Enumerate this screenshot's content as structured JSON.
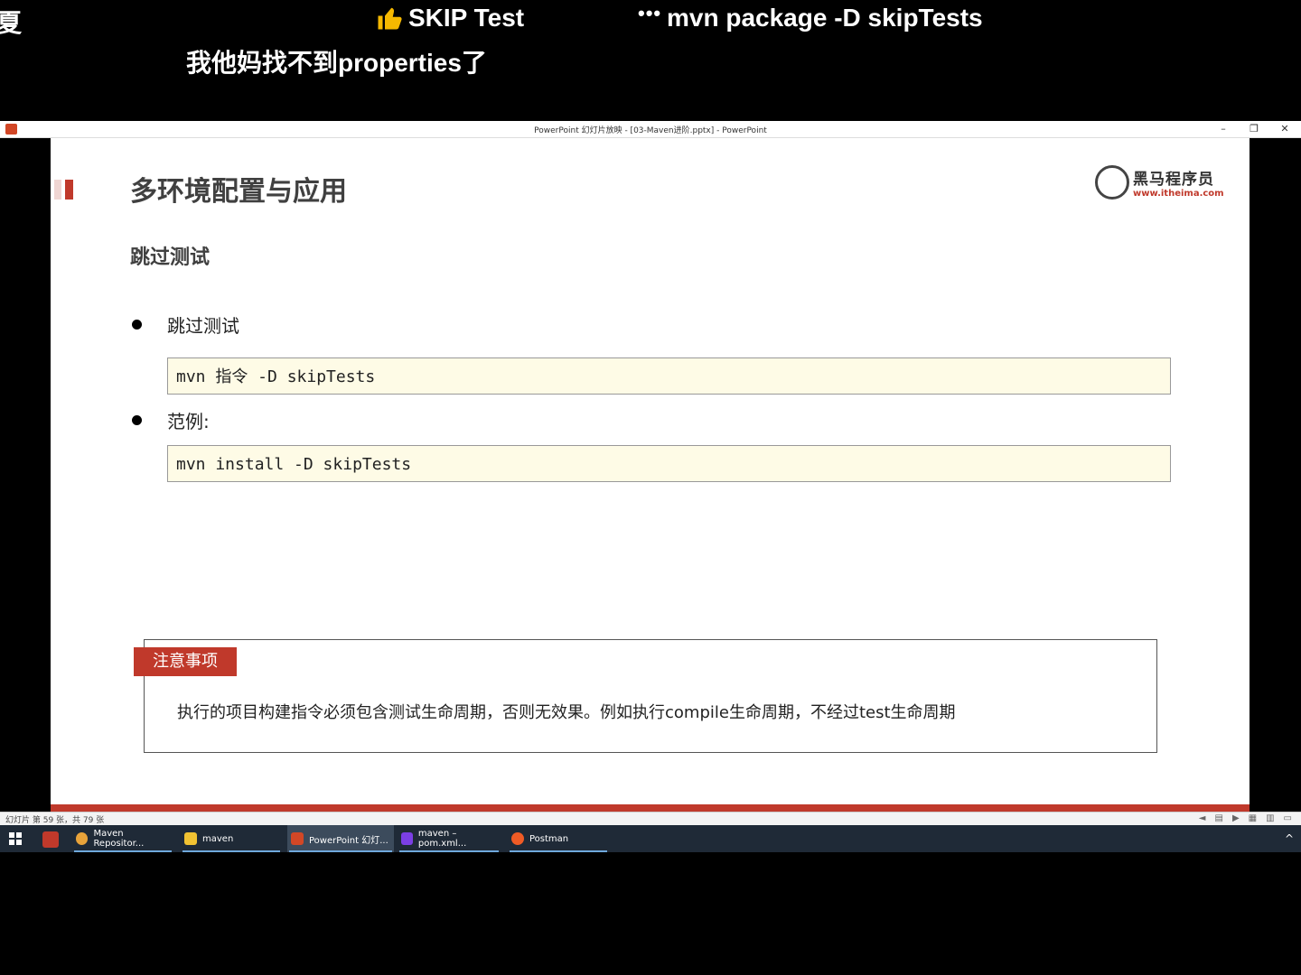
{
  "overlay": {
    "left_char": "夏",
    "skip_label": "SKIP Test",
    "dots": "•••",
    "mvn_cmd": "mvn package -D skipTests",
    "props_text": "我他妈找不到properties了"
  },
  "window": {
    "title": "PowerPoint 幻灯片放映 - [03-Maven进阶.pptx] - PowerPoint",
    "min": "–",
    "restore": "❐",
    "close": "✕"
  },
  "slide": {
    "title": "多环境配置与应用",
    "logo_cn": "黑马程序员",
    "logo_url": "www.itheima.com",
    "subtitle": "跳过测试",
    "bullet1": "跳过测试",
    "code1": "mvn 指令 -D skipTests",
    "bullet2": "范例:",
    "code2": "mvn install -D skipTests",
    "notice_tag": "注意事项",
    "notice_text": "执行的项目构建指令必须包含测试生命周期，否则无效果。例如执行compile生命周期，不经过test生命周期"
  },
  "statusbar": {
    "slide_info": "幻灯片 第 59 张，共 79 张"
  },
  "taskbar": {
    "items": [
      {
        "label": "Maven Repositor...",
        "icon": "chrome-icon",
        "color": "#e8a33a"
      },
      {
        "label": "maven",
        "icon": "folder-icon",
        "color": "#f1c232"
      },
      {
        "label": "PowerPoint 幻灯...",
        "icon": "powerpoint-icon",
        "color": "#d24726"
      },
      {
        "label": "maven – pom.xml...",
        "icon": "intellij-icon",
        "color": "#7b3fe4"
      },
      {
        "label": "Postman",
        "icon": "postman-icon",
        "color": "#ef5b25"
      }
    ],
    "caret": "^"
  },
  "colors": {
    "accent": "#c0392b",
    "code_bg": "#fefbe6"
  }
}
